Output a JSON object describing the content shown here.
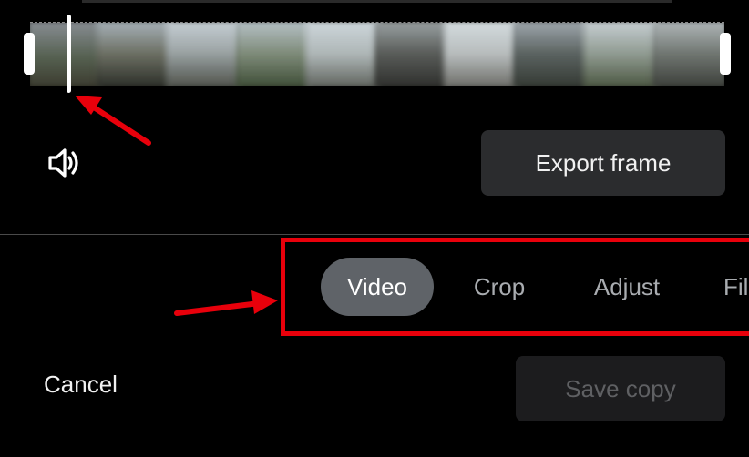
{
  "editor": {
    "export_frame_label": "Export frame",
    "tabs": [
      {
        "label": "Video",
        "active": true
      },
      {
        "label": "Crop",
        "active": false
      },
      {
        "label": "Adjust",
        "active": false
      },
      {
        "label": "Fil",
        "active": false
      }
    ],
    "cancel_label": "Cancel",
    "save_copy_label": "Save copy",
    "save_copy_enabled": false
  },
  "icons": {
    "volume": "speaker-volume-icon"
  },
  "colors": {
    "background": "#000000",
    "active_tab": "#5f6368",
    "annotation": "#e8000b",
    "export_button": "#2b2c2e"
  }
}
